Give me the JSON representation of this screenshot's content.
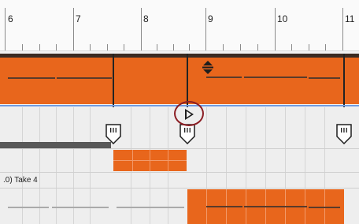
{
  "ruler": {
    "bars": [
      {
        "label": "6"
      },
      {
        "label": "7"
      },
      {
        "label": "8"
      },
      {
        "label": "9"
      },
      {
        "label": "10"
      },
      {
        "label": "11"
      }
    ]
  },
  "lanes": {
    "take_label": ".0) Take 4"
  },
  "colors": {
    "clip_orange": "#e8661c",
    "playhead_highlight": "#8b1e24",
    "loop_line_blue": "#6f9be0"
  },
  "icons": {
    "playhead": "play-triangle-icon",
    "marker": "loop-marker-icon",
    "clip_handle": "diamond-handle-icon"
  }
}
